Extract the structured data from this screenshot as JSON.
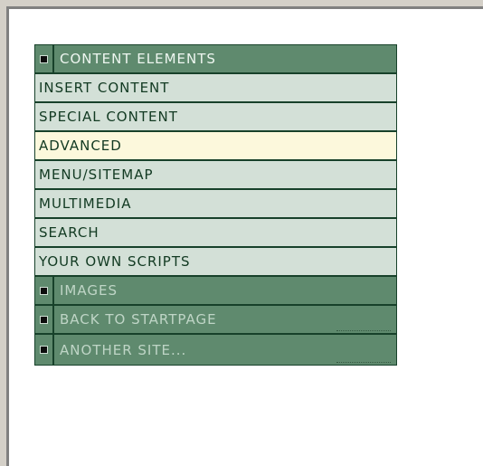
{
  "menu": {
    "header": {
      "label": "CONTENT ELEMENTS",
      "icon": "square-bullet-icon"
    },
    "items": [
      {
        "label": "INSERT CONTENT"
      },
      {
        "label": "SPECIAL CONTENT"
      },
      {
        "label": "ADVANCED",
        "state": "hover"
      },
      {
        "label": "MENU/SITEMAP"
      },
      {
        "label": "MULTIMEDIA"
      },
      {
        "label": "SEARCH"
      },
      {
        "label": "YOUR OWN SCRIPTS"
      }
    ],
    "sections": [
      {
        "label": "IMAGES",
        "icon": "square-bullet-icon"
      },
      {
        "label": "BACK TO STARTPAGE",
        "icon": "square-bullet-icon"
      },
      {
        "label": "ANOTHER SITE...",
        "icon": "square-bullet-icon"
      }
    ]
  },
  "colors": {
    "section_bg": "#5f8a6e",
    "item_bg": "#d3e0d7",
    "active_bg": "#fcf8dc",
    "border": "#17412a"
  }
}
